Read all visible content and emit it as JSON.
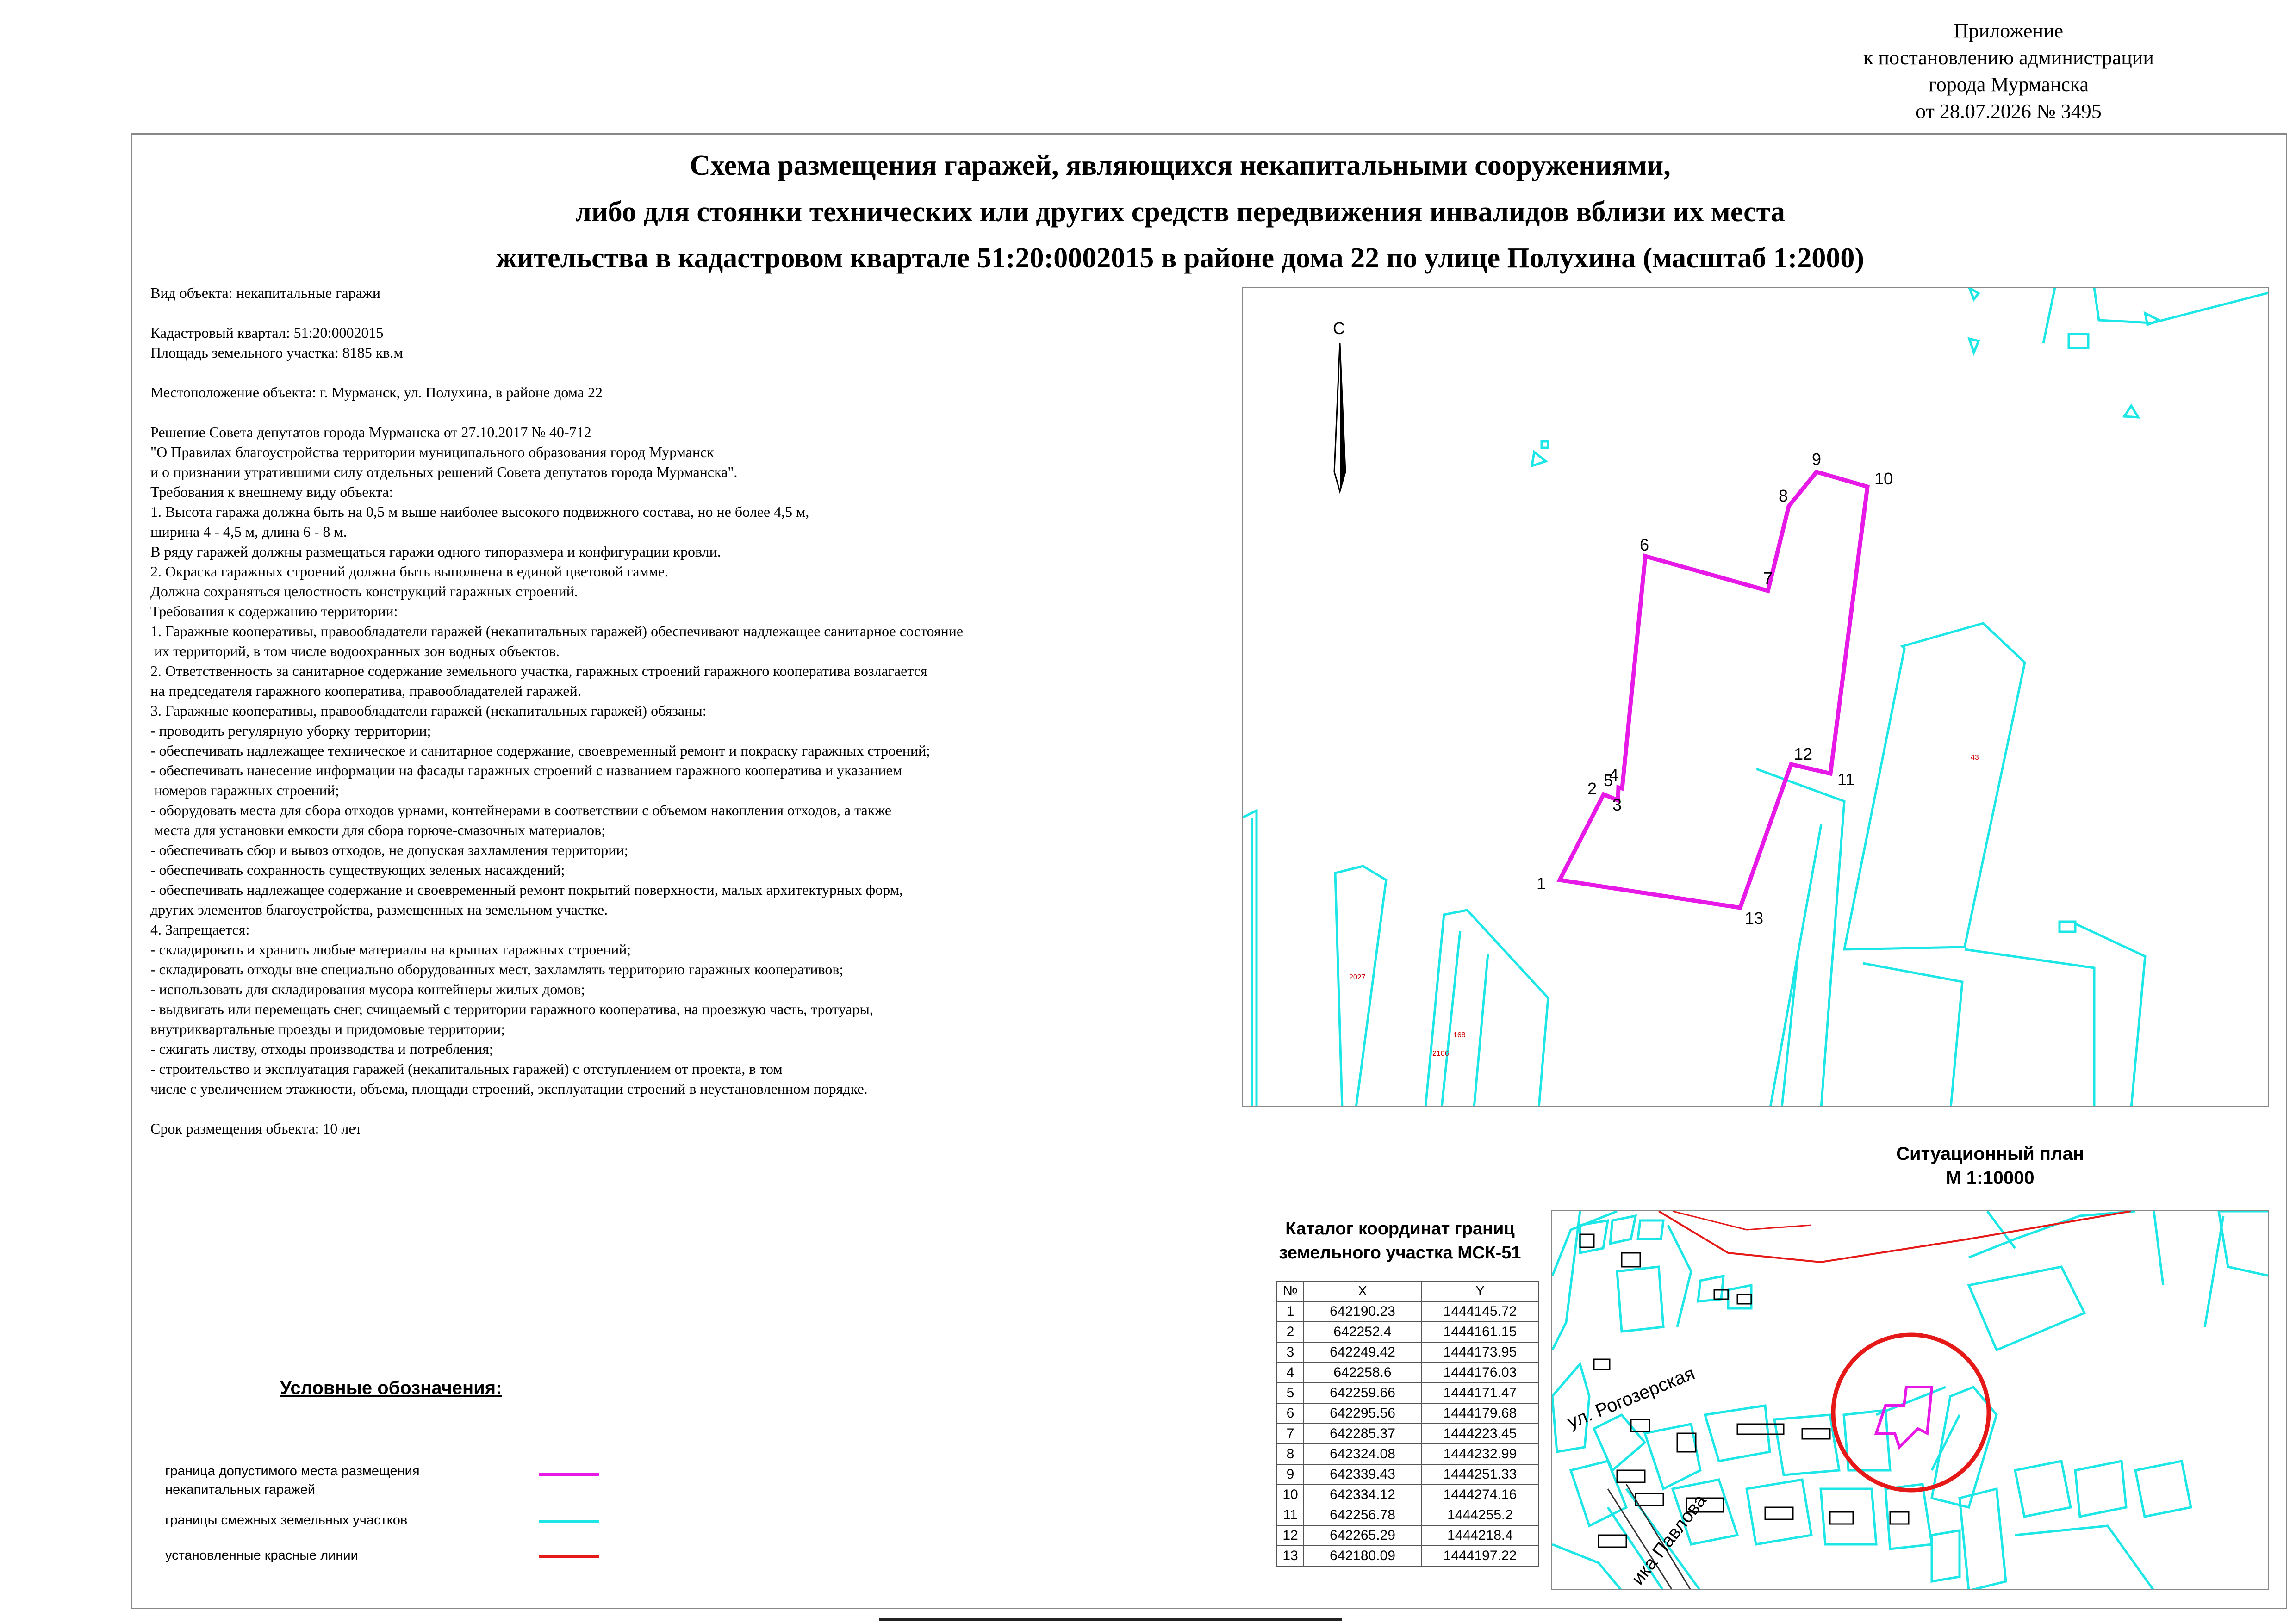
{
  "header": {
    "appendix_lines": [
      "Приложение",
      "к постановлению администрации",
      "города Мурманска",
      "от 28.07.2026 № 3495"
    ]
  },
  "title_lines": [
    "Схема размещения гаражей, являющихся некапитальными сооружениями,",
    "либо для стоянки технических или других средств передвижения инвалидов вблизи их места",
    "жительства в кадастровом квартале 51:20:0002015 в районе дома 22 по улице Полухина (масштаб 1:2000)"
  ],
  "requirements_lines": [
    "Вид объекта: некапитальные гаражи",
    "",
    "Кадастровый квартал: 51:20:0002015",
    "Площадь земельного участка: 8185 кв.м",
    "",
    "Местоположение объекта: г. Мурманск, ул. Полухина, в районе дома 22",
    "",
    "Решение Совета депутатов города Мурманска от 27.10.2017 № 40-712",
    "\"О Правилах благоустройства территории муниципального образования город Мурманск",
    "и о признании утратившими силу отдельных решений Совета депутатов города Мурманска\".",
    "Требования к внешнему виду объекта:",
    "1. Высота гаража должна быть на 0,5 м выше наиболее высокого подвижного состава, но не более 4,5 м,",
    "ширина 4 - 4,5 м, длина 6 - 8 м.",
    "В ряду гаражей должны размещаться гаражи одного типоразмера и конфигурации кровли.",
    "2. Окраска гаражных строений должна быть выполнена в единой цветовой гамме.",
    "Должна сохраняться целостность конструкций гаражных строений.",
    "Требования к содержанию территории:",
    "1. Гаражные кооперативы, правообладатели гаражей (некапитальных гаражей) обеспечивают надлежащее санитарное состояние",
    " их территорий, в том числе водоохранных зон водных объектов.",
    "2. Ответственность за санитарное содержание земельного участка, гаражных строений гаражного кооператива возлагается",
    "на председателя гаражного кооператива, правообладателей гаражей.",
    "3. Гаражные кооперативы, правообладатели гаражей (некапитальных гаражей) обязаны:",
    "- проводить регулярную уборку территории;",
    "- обеспечивать надлежащее техническое и санитарное содержание, своевременный ремонт и покраску гаражных строений;",
    "- обеспечивать нанесение информации на фасады гаражных строений с названием гаражного кооператива и указанием",
    " номеров гаражных строений;",
    "- оборудовать места для сбора отходов урнами, контейнерами в соответствии с объемом накопления отходов, а также",
    " места для установки емкости для сбора горюче-смазочных материалов;",
    "- обеспечивать сбор и вывоз отходов, не допуская захламления территории;",
    "- обеспечивать сохранность существующих зеленых насаждений;",
    "- обеспечивать надлежащее содержание и своевременный ремонт покрытий поверхности, малых архитектурных форм,",
    "других элементов благоустройства, размещенных на земельном участке.",
    "4. Запрещается:",
    "- складировать и хранить любые материалы на крышах гаражных строений;",
    "- складировать отходы вне специально оборудованных мест, захламлять территорию гаражных кооперативов;",
    "- использовать для складирования мусора контейнеры жилых домов;",
    "- выдвигать или перемещать снег, счищаемый с территории гаражного кооператива, на проезжую часть, тротуары,",
    "внутриквартальные проезды и придомовые территории;",
    "- сжигать листву, отходы производства и потребления;",
    "- строительство и эксплуатация гаражей (некапитальных гаражей) с отступлением от проекта, в том",
    "числе с увеличением этажности, объема, площади строений, эксплуатации строений в неустановленном порядке.",
    "",
    "Срок размещения объекта: 10 лет"
  ],
  "main_map": {
    "north_label": "С",
    "parcel_labels": {
      "p43": "43",
      "p2027": "2027",
      "p2106": "2106",
      "p168": "168"
    },
    "points": [
      {
        "n": "1"
      },
      {
        "n": "2"
      },
      {
        "n": "3"
      },
      {
        "n": "4"
      },
      {
        "n": "5"
      },
      {
        "n": "6"
      },
      {
        "n": "7"
      },
      {
        "n": "8"
      },
      {
        "n": "9"
      },
      {
        "n": "10"
      },
      {
        "n": "11"
      },
      {
        "n": "12"
      },
      {
        "n": "13"
      }
    ]
  },
  "situation_plan": {
    "title_lines": [
      "Ситуационный план",
      "М 1:10000"
    ],
    "street_labels": {
      "rogozerskaya": "ул. Рогозерская",
      "pavlova": "ика Павлова"
    }
  },
  "catalog": {
    "title_lines": [
      "Каталог координат границ",
      "земельного участка МСК-51"
    ],
    "headers": [
      "№",
      "X",
      "Y"
    ],
    "rows": [
      [
        "1",
        "642190.23",
        "1444145.72"
      ],
      [
        "2",
        "642252.4",
        "1444161.15"
      ],
      [
        "3",
        "642249.42",
        "1444173.95"
      ],
      [
        "4",
        "642258.6",
        "1444176.03"
      ],
      [
        "5",
        "642259.66",
        "1444171.47"
      ],
      [
        "6",
        "642295.56",
        "1444179.68"
      ],
      [
        "7",
        "642285.37",
        "1444223.45"
      ],
      [
        "8",
        "642324.08",
        "1444232.99"
      ],
      [
        "9",
        "642339.43",
        "1444251.33"
      ],
      [
        "10",
        "642334.12",
        "1444274.16"
      ],
      [
        "11",
        "642256.78",
        "1444255.2"
      ],
      [
        "12",
        "642265.29",
        "1444218.4"
      ],
      [
        "13",
        "642180.09",
        "1444197.22"
      ]
    ]
  },
  "legend": {
    "title": "Условные обозначения:",
    "items": [
      {
        "lines": [
          "граница допустимого места размещения",
          "некапитальных гаражей"
        ],
        "color": "#e619e6"
      },
      {
        "lines": [
          "границы смежных земельных участков"
        ],
        "color": "#1ce6e6"
      },
      {
        "lines": [
          "установленные красные линии"
        ],
        "color": "#e61919"
      }
    ]
  },
  "colors": {
    "parcel": "#e619e6",
    "adjacent": "#1ce6e6",
    "red_lines": "#e61919",
    "frame": "#888888"
  }
}
